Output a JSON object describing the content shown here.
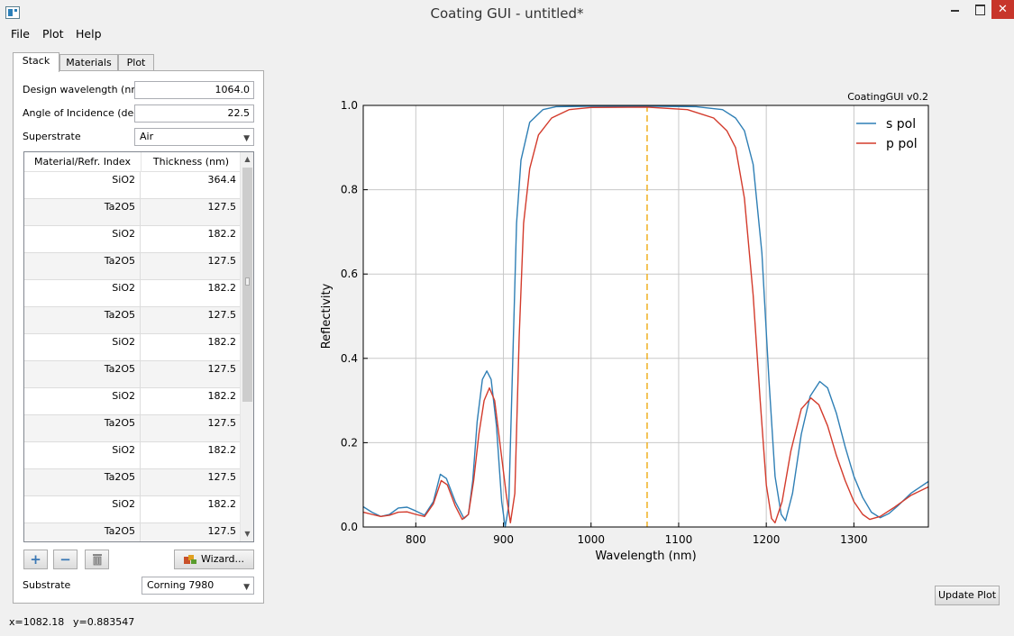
{
  "window": {
    "title": "Coating GUI - untitled*",
    "close_glyph": "✕"
  },
  "menubar": {
    "items": [
      "File",
      "Plot",
      "Help"
    ]
  },
  "tabs": [
    "Stack",
    "Materials",
    "Plot"
  ],
  "stack": {
    "design_wavelength_label": "Design wavelength (nm)",
    "design_wavelength": "1064.0",
    "angle_label": "Angle of Incidence (deg)",
    "angle": "22.5",
    "superstrate_label": "Superstrate",
    "superstrate": "Air",
    "table": {
      "headers": [
        "Material/Refr. Index",
        "Thickness (nm)"
      ],
      "rows": [
        [
          "SiO2",
          "364.4"
        ],
        [
          "Ta2O5",
          "127.5"
        ],
        [
          "SiO2",
          "182.2"
        ],
        [
          "Ta2O5",
          "127.5"
        ],
        [
          "SiO2",
          "182.2"
        ],
        [
          "Ta2O5",
          "127.5"
        ],
        [
          "SiO2",
          "182.2"
        ],
        [
          "Ta2O5",
          "127.5"
        ],
        [
          "SiO2",
          "182.2"
        ],
        [
          "Ta2O5",
          "127.5"
        ],
        [
          "SiO2",
          "182.2"
        ],
        [
          "Ta2O5",
          "127.5"
        ],
        [
          "SiO2",
          "182.2"
        ],
        [
          "Ta2O5",
          "127.5"
        ]
      ]
    },
    "add_glyph": "+",
    "remove_glyph": "−",
    "delete_icon": "trash-icon",
    "wizard_label": "Wizard...",
    "substrate_label": "Substrate",
    "substrate": "Corning 7980"
  },
  "update_plot_label": "Update Plot",
  "status": {
    "x": "x=1082.18",
    "y": "y=0.883547"
  },
  "chart_data": {
    "type": "line",
    "corner_label": "CoatingGUI v0.2",
    "xlabel": "Wavelength (nm)",
    "ylabel": "Reflectivity",
    "xlim": [
      740,
      1385
    ],
    "ylim": [
      0,
      1.0
    ],
    "xticks": [
      "800",
      "900",
      "1000",
      "1100",
      "1200",
      "1300"
    ],
    "yticks": [
      "0.0",
      "0.2",
      "0.4",
      "0.6",
      "0.8",
      "1.0"
    ],
    "grid": true,
    "legend_position": "top-right",
    "design_wavelength": 1064,
    "series": [
      {
        "name": "s pol",
        "color": "#2f7fb5",
        "points": [
          [
            740,
            0.048
          ],
          [
            750,
            0.035
          ],
          [
            760,
            0.025
          ],
          [
            770,
            0.03
          ],
          [
            780,
            0.045
          ],
          [
            790,
            0.047
          ],
          [
            800,
            0.038
          ],
          [
            810,
            0.028
          ],
          [
            820,
            0.06
          ],
          [
            828,
            0.125
          ],
          [
            835,
            0.115
          ],
          [
            845,
            0.06
          ],
          [
            855,
            0.02
          ],
          [
            860,
            0.03
          ],
          [
            865,
            0.11
          ],
          [
            870,
            0.25
          ],
          [
            876,
            0.35
          ],
          [
            881,
            0.37
          ],
          [
            886,
            0.35
          ],
          [
            892,
            0.24
          ],
          [
            898,
            0.06
          ],
          [
            902,
            0.0
          ],
          [
            906,
            0.05
          ],
          [
            910,
            0.35
          ],
          [
            915,
            0.72
          ],
          [
            920,
            0.87
          ],
          [
            930,
            0.96
          ],
          [
            945,
            0.99
          ],
          [
            960,
            0.997
          ],
          [
            1000,
            0.998
          ],
          [
            1064,
            0.998
          ],
          [
            1120,
            0.997
          ],
          [
            1150,
            0.99
          ],
          [
            1165,
            0.97
          ],
          [
            1175,
            0.94
          ],
          [
            1185,
            0.86
          ],
          [
            1195,
            0.65
          ],
          [
            1203,
            0.35
          ],
          [
            1210,
            0.12
          ],
          [
            1217,
            0.03
          ],
          [
            1222,
            0.015
          ],
          [
            1230,
            0.08
          ],
          [
            1240,
            0.22
          ],
          [
            1250,
            0.31
          ],
          [
            1261,
            0.345
          ],
          [
            1270,
            0.33
          ],
          [
            1280,
            0.27
          ],
          [
            1290,
            0.19
          ],
          [
            1300,
            0.12
          ],
          [
            1310,
            0.07
          ],
          [
            1320,
            0.035
          ],
          [
            1330,
            0.022
          ],
          [
            1340,
            0.032
          ],
          [
            1350,
            0.05
          ],
          [
            1365,
            0.08
          ],
          [
            1385,
            0.108
          ]
        ]
      },
      {
        "name": "p pol",
        "color": "#d33b2c",
        "points": [
          [
            740,
            0.035
          ],
          [
            750,
            0.03
          ],
          [
            760,
            0.025
          ],
          [
            770,
            0.028
          ],
          [
            780,
            0.035
          ],
          [
            790,
            0.036
          ],
          [
            800,
            0.03
          ],
          [
            810,
            0.025
          ],
          [
            820,
            0.055
          ],
          [
            829,
            0.11
          ],
          [
            836,
            0.1
          ],
          [
            845,
            0.05
          ],
          [
            853,
            0.018
          ],
          [
            860,
            0.03
          ],
          [
            866,
            0.11
          ],
          [
            872,
            0.22
          ],
          [
            878,
            0.3
          ],
          [
            884,
            0.33
          ],
          [
            890,
            0.3
          ],
          [
            896,
            0.2
          ],
          [
            903,
            0.08
          ],
          [
            908,
            0.01
          ],
          [
            913,
            0.08
          ],
          [
            918,
            0.45
          ],
          [
            923,
            0.72
          ],
          [
            930,
            0.85
          ],
          [
            940,
            0.93
          ],
          [
            955,
            0.97
          ],
          [
            975,
            0.99
          ],
          [
            1000,
            0.995
          ],
          [
            1064,
            0.996
          ],
          [
            1110,
            0.99
          ],
          [
            1140,
            0.97
          ],
          [
            1155,
            0.94
          ],
          [
            1165,
            0.9
          ],
          [
            1175,
            0.78
          ],
          [
            1185,
            0.55
          ],
          [
            1193,
            0.3
          ],
          [
            1200,
            0.1
          ],
          [
            1206,
            0.02
          ],
          [
            1210,
            0.01
          ],
          [
            1218,
            0.06
          ],
          [
            1228,
            0.18
          ],
          [
            1240,
            0.28
          ],
          [
            1251,
            0.306
          ],
          [
            1260,
            0.29
          ],
          [
            1270,
            0.24
          ],
          [
            1280,
            0.17
          ],
          [
            1290,
            0.11
          ],
          [
            1300,
            0.06
          ],
          [
            1310,
            0.03
          ],
          [
            1318,
            0.018
          ],
          [
            1330,
            0.025
          ],
          [
            1345,
            0.045
          ],
          [
            1365,
            0.075
          ],
          [
            1385,
            0.095
          ]
        ]
      }
    ]
  }
}
